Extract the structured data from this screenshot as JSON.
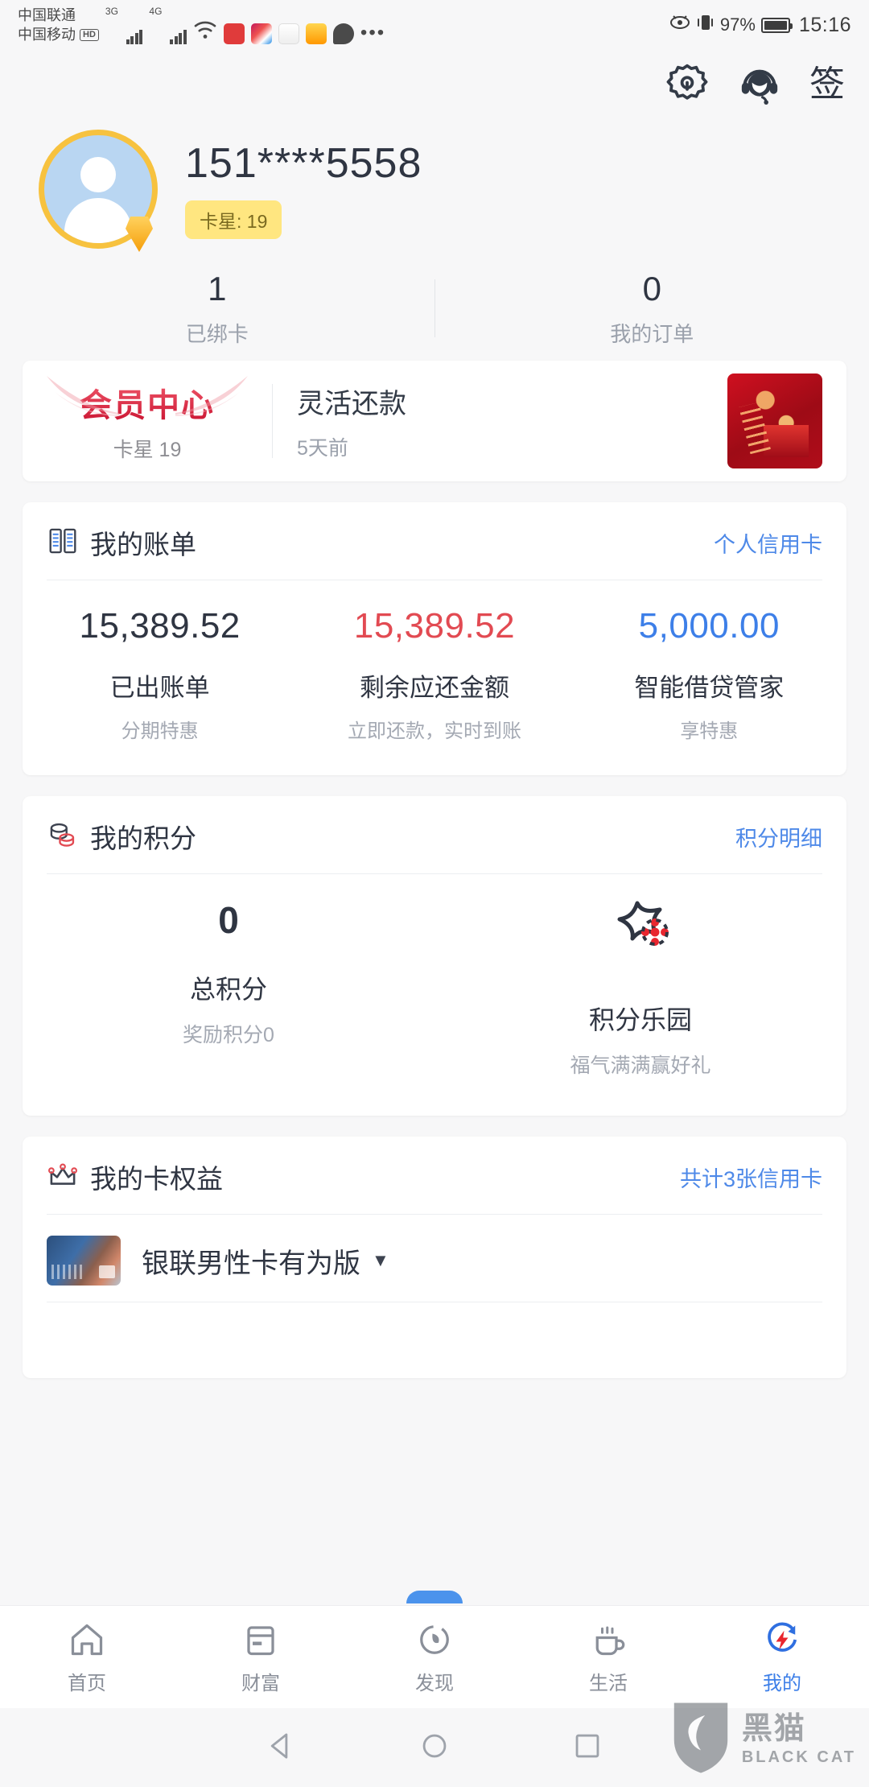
{
  "status_bar": {
    "carrier1": "中国联通",
    "carrier2": "中国移动",
    "hd_badge": "HD",
    "net1": "3G",
    "net2": "4G",
    "net2_sup": "+",
    "battery": "97%",
    "time": "15:16",
    "more_dots": "•••"
  },
  "top_actions": {
    "settings_icon": "gear-icon",
    "service_icon": "customer-service-icon",
    "sign_label": "签"
  },
  "profile": {
    "phone": "151****5558",
    "level_badge": "卡星: 19",
    "avatar_icon": "user-avatar-icon"
  },
  "stats": [
    {
      "num": "1",
      "label": "已绑卡"
    },
    {
      "num": "0",
      "label": "我的订单"
    }
  ],
  "member_banner": {
    "logo_title": "会员中心",
    "logo_sub": "卡星 19",
    "title": "灵活还款",
    "subtitle": "5天前",
    "promo_icon": "red-gift-promo-image"
  },
  "bill_card": {
    "icon": "bill-book-icon",
    "title": "我的账单",
    "link": "个人信用卡",
    "columns": [
      {
        "amount": "15,389.52",
        "name": "已出账单",
        "sub": "分期特惠",
        "color": "#2f3542"
      },
      {
        "amount": "15,389.52",
        "name": "剩余应还金额",
        "sub": "立即还款，实时到账",
        "color": "#e24a52"
      },
      {
        "amount": "5,000.00",
        "name": "智能借贷管家",
        "sub": "享特惠",
        "color": "#3d7fe8"
      }
    ]
  },
  "points_card": {
    "icon": "coins-icon",
    "title": "我的积分",
    "link": "积分明细",
    "total": {
      "value": "0",
      "name": "总积分",
      "sub": "奖励积分0"
    },
    "park": {
      "icon": "star-park-icon",
      "name": "积分乐园",
      "sub": "福气满满赢好礼"
    }
  },
  "rights_card": {
    "icon": "crown-icon",
    "title": "我的卡权益",
    "link": "共计3张信用卡",
    "card_name": "银联男性卡有为版",
    "caret": "▼",
    "card_thumb_icon": "credit-card-thumbnail"
  },
  "tabbar": [
    {
      "label": "首页",
      "icon": "home-icon",
      "active": false
    },
    {
      "label": "财富",
      "icon": "wallet-card-icon",
      "active": false
    },
    {
      "label": "发现",
      "icon": "discover-icon",
      "active": false
    },
    {
      "label": "生活",
      "icon": "coffee-cup-icon",
      "active": false
    },
    {
      "label": "我的",
      "icon": "profile-bolt-icon",
      "active": true
    }
  ],
  "nav_bar": {
    "back_icon": "back-triangle-icon",
    "home_icon": "home-circle-icon",
    "recents_icon": "recents-square-icon"
  },
  "watermark": {
    "cn": "黑猫",
    "en": "BLACK CAT",
    "icon": "black-cat-logo-icon"
  },
  "colors": {
    "accent_blue": "#3d7fe8",
    "danger_red": "#e24a52",
    "gold": "#f7c23f",
    "bg": "#f7f7f8"
  }
}
